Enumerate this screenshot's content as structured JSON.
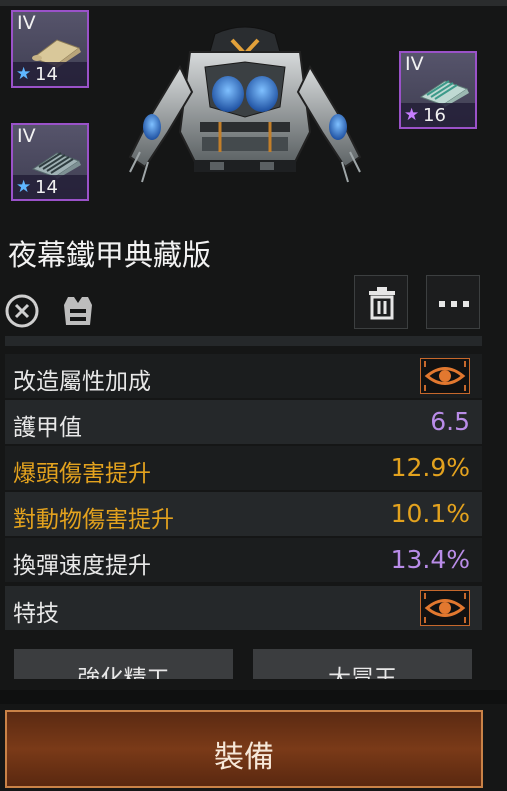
{
  "item": {
    "name": "夜幕鐵甲典藏版"
  },
  "mods": [
    {
      "tier": "IV",
      "level": "14",
      "star_color": "#5fb6ff"
    },
    {
      "tier": "IV",
      "level": "14",
      "star_color": "#5fb6ff"
    },
    {
      "tier": "IV",
      "level": "16",
      "star_color": "#c77dff"
    }
  ],
  "stats": [
    {
      "label": "改造屬性加成",
      "value": "",
      "label_color": "#e8e8e8",
      "value_color": "#e8e8e8",
      "has_eye": true
    },
    {
      "label": "護甲值",
      "value": "6.5",
      "label_color": "#e8e8e8",
      "value_color": "#b98ce8",
      "has_eye": false
    },
    {
      "label": "爆頭傷害提升",
      "value": "12.9%",
      "label_color": "#e3a21e",
      "value_color": "#e3a21e",
      "has_eye": false
    },
    {
      "label": "對動物傷害提升",
      "value": "10.1%",
      "label_color": "#e3a21e",
      "value_color": "#e3a21e",
      "has_eye": false
    },
    {
      "label": "換彈速度提升",
      "value": "13.4%",
      "label_color": "#e8e8e8",
      "value_color": "#b98ce8",
      "has_eye": false
    },
    {
      "label": "特技",
      "value": "",
      "label_color": "#e8e8e8",
      "value_color": "#e8e8e8",
      "has_eye": true
    }
  ],
  "tabs": {
    "enhance": "強化精工",
    "master": "大冒王"
  },
  "equip_label": "裝備",
  "colors": {
    "rare_purple": "#9a52c9",
    "accent_orange": "#c98247",
    "stat_gold": "#e3a21e",
    "stat_purple": "#b98ce8"
  },
  "icons": [
    "scroll-mod-icon",
    "armor-item-image",
    "no-repair-icon",
    "armor-vest-icon",
    "trash-icon",
    "more-icon",
    "eye-icon"
  ]
}
